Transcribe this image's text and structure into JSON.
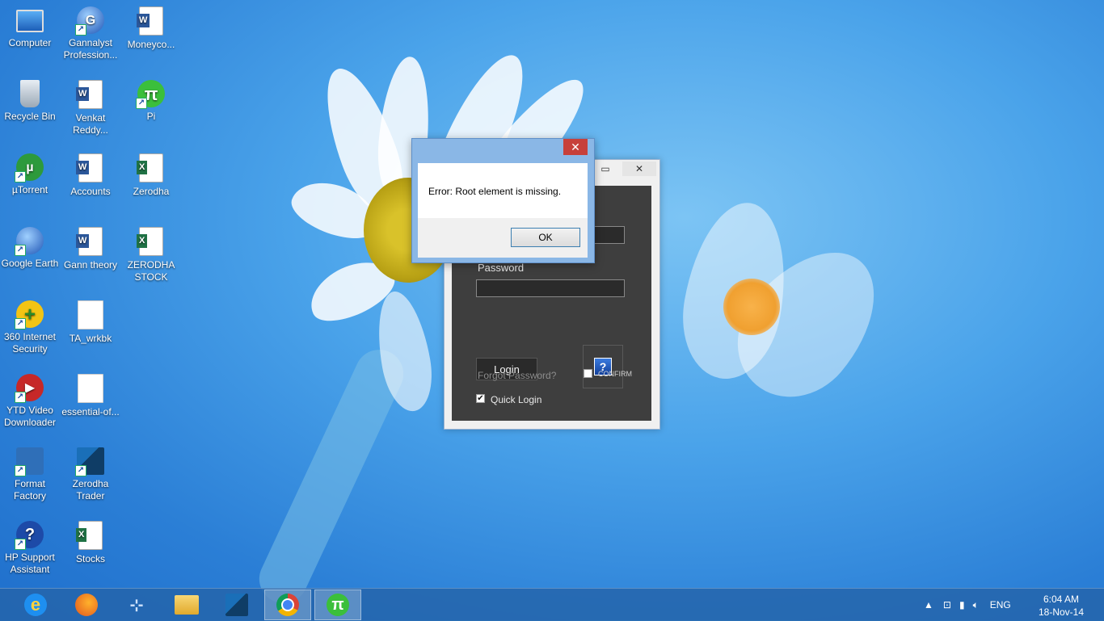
{
  "desktop": {
    "icons": [
      {
        "label": "Computer",
        "icon": "computer-icon"
      },
      {
        "label": "Gannalyst Profession...",
        "icon": "gannalyst-icon"
      },
      {
        "label": "Moneyco...",
        "icon": "word-document-icon"
      },
      {
        "label": "Recycle Bin",
        "icon": "recycle-bin-icon"
      },
      {
        "label": "Venkat Reddy...",
        "icon": "word-document-icon"
      },
      {
        "label": "Pi",
        "icon": "pi-icon"
      },
      {
        "label": "µTorrent",
        "icon": "utorrent-icon"
      },
      {
        "label": "Accounts",
        "icon": "word-document-icon"
      },
      {
        "label": "Zerodha",
        "icon": "excel-document-icon"
      },
      {
        "label": "Google Earth",
        "icon": "google-earth-icon"
      },
      {
        "label": "Gann theory",
        "icon": "word-document-icon"
      },
      {
        "label": "ZERODHA STOCK",
        "icon": "excel-document-icon"
      },
      {
        "label": "360 Internet Security",
        "icon": "360-security-icon"
      },
      {
        "label": "TA_wrkbk",
        "icon": "document-icon"
      },
      {
        "label": "YTD Video Downloader",
        "icon": "ytd-downloader-icon"
      },
      {
        "label": "essential-of...",
        "icon": "document-icon"
      },
      {
        "label": "Format Factory",
        "icon": "format-factory-icon"
      },
      {
        "label": "Zerodha Trader",
        "icon": "zerodha-trader-icon"
      },
      {
        "label": "HP Support Assistant",
        "icon": "hp-support-icon"
      },
      {
        "label": "Stocks",
        "icon": "excel-document-icon"
      }
    ]
  },
  "app_window": {
    "password_label": "Password",
    "login_button": "Login",
    "forgot_password": "Forgot Password?",
    "confirm_label": "CONFIRM",
    "quick_login_label": "Quick Login",
    "quick_login_checked": true,
    "help_glyph": "?"
  },
  "dialog": {
    "message": "Error: Root element is missing.",
    "ok_label": "OK"
  },
  "taskbar": {
    "apps": [
      {
        "name": "internet-explorer-icon"
      },
      {
        "name": "firefox-icon"
      },
      {
        "name": "network-tool-icon"
      },
      {
        "name": "file-explorer-icon"
      },
      {
        "name": "zerodha-trader-icon"
      },
      {
        "name": "chrome-icon"
      },
      {
        "name": "pi-icon"
      }
    ],
    "language": "ENG",
    "time": "6:04 AM",
    "date": "18-Nov-14"
  },
  "colors": {
    "close_button": "#c7403a",
    "taskbar": "#2464aa",
    "pi_green": "#3bbf3b"
  }
}
